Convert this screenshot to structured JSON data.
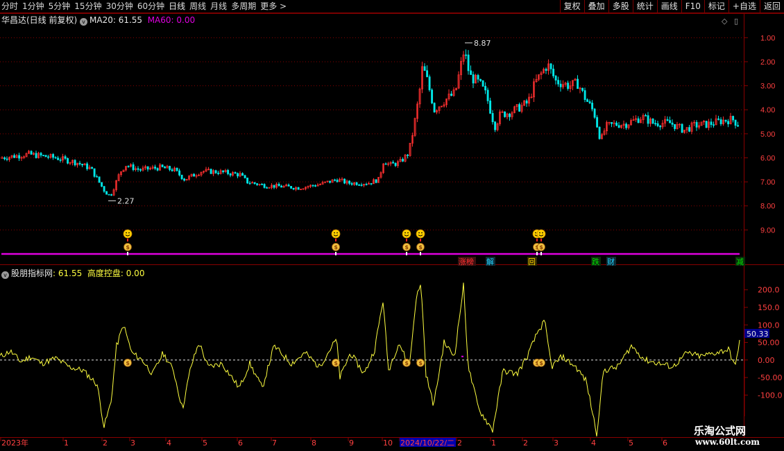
{
  "toolbar": {
    "periods": [
      "分时",
      "1分钟",
      "5分钟",
      "15分钟",
      "30分钟",
      "60分钟",
      "日线",
      "周线",
      "月线",
      "多周期",
      "更多 >"
    ],
    "active_period": "日线",
    "actions": [
      "复权",
      "叠加",
      "多股",
      "统计",
      "画线",
      "F10",
      "标记",
      "+自选",
      "返回"
    ]
  },
  "main": {
    "stock_title": "华昌达(日线 前复权)",
    "ma20_label": "MA20: 61.55",
    "ma60_label": "MA60: 0.00",
    "high_label": "8.87",
    "low_label": "2.27",
    "y_ticks": [
      "9.00",
      "8.00",
      "7.00",
      "6.00",
      "5.00",
      "4.00",
      "3.00",
      "2.00",
      "1.00"
    ],
    "event_tags": [
      {
        "text": "涨榜",
        "color": "#ff3030",
        "bg": "#3a1010"
      },
      {
        "text": "解",
        "color": "#22d0ff",
        "bg": "#0e2a33"
      },
      {
        "text": "回",
        "color": "#ffd200",
        "bg": "#2e2600"
      },
      {
        "text": "跌",
        "color": "#00e000",
        "bg": "#0b2b0b"
      },
      {
        "text": "财",
        "color": "#22d0ff",
        "bg": "#0e2a33"
      },
      {
        "text": "减",
        "color": "#00e000",
        "bg": "#0b2b0b"
      }
    ],
    "up_color": "#ff3030",
    "down_color": "#00e6e6",
    "magenta_line": "#e000e0"
  },
  "indicator": {
    "title": "股朋指标网",
    "value1": ": 61.55",
    "label2": "高度控盘: 0.00",
    "y_ticks": [
      "200.0",
      "150.0",
      "100.0",
      "50.00",
      "0.00",
      "-50.00",
      "-100.0"
    ],
    "current_value": "50.33",
    "line_color": "#ffff40"
  },
  "time_axis": {
    "labels": [
      "2023年",
      "1",
      "2",
      "3",
      "4",
      "5",
      "6",
      "7",
      "8",
      "9",
      "10",
      "2024/10/22/二",
      "2",
      "1",
      "2",
      "3",
      "4",
      "5",
      "6"
    ]
  },
  "watermark": {
    "line1": "乐淘公式网",
    "line2": "www.60lt.com"
  },
  "chart_data": [
    {
      "type": "candlestick",
      "title": "华昌达(日线 前复权)",
      "ylim": [
        0,
        9.5
      ],
      "y_ticks": [
        1,
        2,
        3,
        4,
        5,
        6,
        7,
        8,
        9
      ],
      "annotations": [
        {
          "label": "8.87",
          "value": 8.87
        },
        {
          "label": "2.27",
          "value": 2.27
        }
      ],
      "price_path": [
        [
          0,
          4.0
        ],
        [
          40,
          4.15
        ],
        [
          80,
          4.0
        ],
        [
          110,
          3.8
        ],
        [
          130,
          3.55
        ],
        [
          150,
          2.6
        ],
        [
          158,
          2.4
        ],
        [
          165,
          2.9
        ],
        [
          172,
          3.4
        ],
        [
          180,
          3.7
        ],
        [
          200,
          3.5
        ],
        [
          230,
          3.6
        ],
        [
          250,
          3.5
        ],
        [
          265,
          3.1
        ],
        [
          290,
          3.45
        ],
        [
          320,
          3.4
        ],
        [
          345,
          3.3
        ],
        [
          355,
          3.0
        ],
        [
          380,
          2.85
        ],
        [
          410,
          2.8
        ],
        [
          430,
          2.75
        ],
        [
          460,
          2.9
        ],
        [
          485,
          3.1
        ],
        [
          500,
          2.95
        ],
        [
          530,
          2.95
        ],
        [
          545,
          3.1
        ],
        [
          552,
          3.9
        ],
        [
          560,
          3.7
        ],
        [
          575,
          3.8
        ],
        [
          588,
          4.2
        ],
        [
          595,
          5.2
        ],
        [
          603,
          6.6
        ],
        [
          608,
          7.8
        ],
        [
          615,
          7.2
        ],
        [
          625,
          6.0
        ],
        [
          640,
          6.4
        ],
        [
          655,
          6.7
        ],
        [
          668,
          8.5
        ],
        [
          676,
          7.4
        ],
        [
          690,
          7.1
        ],
        [
          700,
          6.6
        ],
        [
          712,
          5.3
        ],
        [
          720,
          5.8
        ],
        [
          735,
          5.9
        ],
        [
          760,
          6.3
        ],
        [
          770,
          7.1
        ],
        [
          788,
          7.9
        ],
        [
          800,
          7.2
        ],
        [
          820,
          7.0
        ],
        [
          832,
          7.1
        ],
        [
          840,
          6.6
        ],
        [
          855,
          5.9
        ],
        [
          865,
          4.7
        ],
        [
          872,
          5.3
        ],
        [
          885,
          5.4
        ],
        [
          900,
          5.4
        ],
        [
          925,
          5.7
        ],
        [
          940,
          5.45
        ],
        [
          965,
          5.45
        ],
        [
          985,
          5.15
        ],
        [
          1000,
          5.35
        ],
        [
          1020,
          5.4
        ],
        [
          1040,
          5.55
        ],
        [
          1055,
          5.6
        ],
        [
          1062,
          5.4
        ]
      ]
    },
    {
      "type": "line",
      "title": "股朋指标网",
      "series": [
        {
          "name": "股朋指标网",
          "values": "see path"
        }
      ],
      "ylim": [
        -210,
        235
      ],
      "y_ticks": [
        200,
        150,
        100,
        50,
        0,
        -50,
        -100
      ],
      "current_value": 50.33,
      "path": [
        [
          0,
          10
        ],
        [
          15,
          25
        ],
        [
          30,
          -5
        ],
        [
          45,
          10
        ],
        [
          60,
          -10
        ],
        [
          80,
          5
        ],
        [
          100,
          -20
        ],
        [
          120,
          -30
        ],
        [
          140,
          -70
        ],
        [
          150,
          -190
        ],
        [
          160,
          -120
        ],
        [
          168,
          40
        ],
        [
          178,
          100
        ],
        [
          190,
          20
        ],
        [
          205,
          0
        ],
        [
          220,
          -40
        ],
        [
          235,
          20
        ],
        [
          250,
          -30
        ],
        [
          263,
          -140
        ],
        [
          275,
          -20
        ],
        [
          287,
          50
        ],
        [
          300,
          -20
        ],
        [
          320,
          -10
        ],
        [
          345,
          -80
        ],
        [
          360,
          -10
        ],
        [
          378,
          -80
        ],
        [
          395,
          40
        ],
        [
          420,
          -10
        ],
        [
          440,
          20
        ],
        [
          460,
          -20
        ],
        [
          485,
          60
        ],
        [
          490,
          -50
        ],
        [
          505,
          20
        ],
        [
          525,
          -40
        ],
        [
          540,
          30
        ],
        [
          552,
          170
        ],
        [
          560,
          -30
        ],
        [
          575,
          50
        ],
        [
          590,
          -20
        ],
        [
          600,
          180
        ],
        [
          607,
          215
        ],
        [
          614,
          -40
        ],
        [
          625,
          -130
        ],
        [
          640,
          50
        ],
        [
          655,
          10
        ],
        [
          668,
          212
        ],
        [
          675,
          -20
        ],
        [
          690,
          -140
        ],
        [
          710,
          -200
        ],
        [
          725,
          -30
        ],
        [
          745,
          -40
        ],
        [
          760,
          10
        ],
        [
          775,
          80
        ],
        [
          785,
          110
        ],
        [
          795,
          -20
        ],
        [
          810,
          10
        ],
        [
          830,
          -20
        ],
        [
          845,
          -60
        ],
        [
          860,
          -210
        ],
        [
          870,
          -30
        ],
        [
          890,
          -20
        ],
        [
          910,
          40
        ],
        [
          930,
          0
        ],
        [
          950,
          -10
        ],
        [
          970,
          -20
        ],
        [
          990,
          20
        ],
        [
          1010,
          10
        ],
        [
          1030,
          20
        ],
        [
          1050,
          30
        ],
        [
          1060,
          -20
        ],
        [
          1066,
          60
        ]
      ]
    }
  ]
}
